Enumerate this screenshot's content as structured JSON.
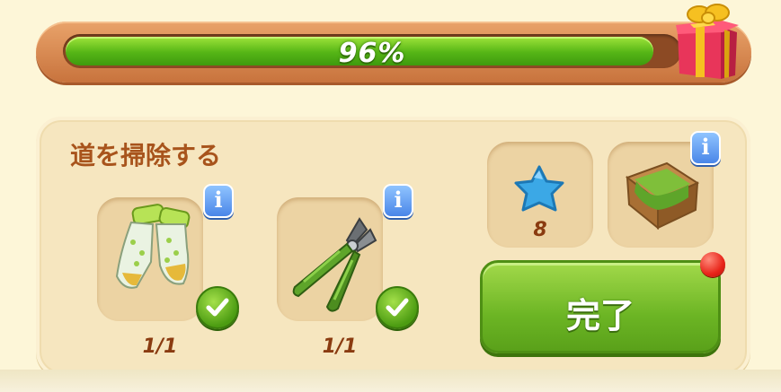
{
  "progress": {
    "value": 0.96,
    "label": "96%"
  },
  "task": {
    "title": "道を掃除する",
    "tools": [
      {
        "icon": "gardening-gloves-icon",
        "count": "1/1",
        "complete": true
      },
      {
        "icon": "pruning-shears-icon",
        "count": "1/1",
        "complete": true
      }
    ]
  },
  "rewards": [
    {
      "icon": "blue-star-icon",
      "count": "8"
    },
    {
      "icon": "grass-crate-icon"
    }
  ],
  "button": {
    "complete_label": "完了"
  },
  "colors": {
    "progress_green": "#55b516",
    "frame_orange": "#c8733d",
    "title_brown": "#a8541c",
    "count_brown": "#8a3b10",
    "info_blue": "#4a86e8",
    "button_green": "#6cb524",
    "notification_red": "#e8251a"
  }
}
